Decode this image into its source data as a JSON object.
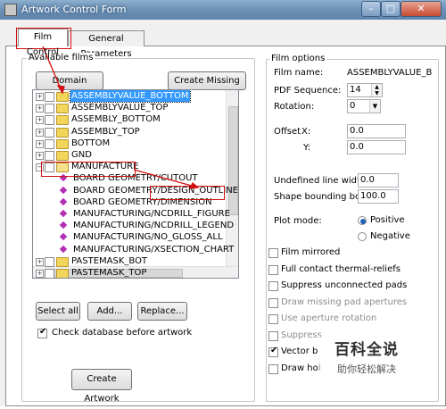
{
  "window": {
    "title": "Artwork Control Form",
    "min_icon": "minimize-icon",
    "max_icon": "maximize-icon",
    "close_icon": "close-icon"
  },
  "tabs": [
    {
      "label": "Film Control",
      "active": true
    },
    {
      "label": "General Parameters",
      "active": false
    }
  ],
  "available_films": {
    "label": "Available films",
    "domain_selection": "Domain Selection",
    "create_missing": "Create Missing Films",
    "items": [
      {
        "label": "ASSEMBLYVALUE_BOTTOM",
        "type": "folder",
        "selected": true
      },
      {
        "label": "ASSEMBLYVALUE_TOP",
        "type": "folder"
      },
      {
        "label": "ASSEMBLY_BOTTOM",
        "type": "folder"
      },
      {
        "label": "ASSEMBLY_TOP",
        "type": "folder"
      },
      {
        "label": "BOTTOM",
        "type": "folder"
      },
      {
        "label": "GND",
        "type": "folder"
      },
      {
        "label": "MANUFACTURE",
        "type": "folder-open"
      },
      {
        "label": "BOARD GEOMETRY/CUTOUT",
        "type": "layer"
      },
      {
        "label": "BOARD GEOMETRY/DESIGN_OUTLINE",
        "type": "layer"
      },
      {
        "label": "BOARD GEOMETRY/DIMENSION",
        "type": "layer"
      },
      {
        "label": "MANUFACTURING/NCDRILL_FIGURE",
        "type": "layer"
      },
      {
        "label": "MANUFACTURING/NCDRILL_LEGEND",
        "type": "layer"
      },
      {
        "label": "MANUFACTURING/NO_GLOSS_ALL",
        "type": "layer"
      },
      {
        "label": "MANUFACTURING/XSECTION_CHART",
        "type": "layer"
      },
      {
        "label": "PASTEMASK_BOT",
        "type": "folder"
      },
      {
        "label": "PASTEMASK_TOP",
        "type": "folder"
      }
    ],
    "select_all": "Select all",
    "add": "Add...",
    "replace": "Replace...",
    "check_db": "Check database before artwork",
    "check_db_checked": true,
    "create_artwork": "Create Artwork"
  },
  "film_options": {
    "label": "Film options",
    "film_name_label": "Film name:",
    "film_name": "ASSEMBLYVALUE_B",
    "pdf_seq_label": "PDF Sequence:",
    "pdf_seq": "14",
    "rotation_label": "Rotation:",
    "rotation": "0",
    "offset_label": "Offset",
    "x_label": "X:",
    "x": "0.0",
    "y_label": "Y:",
    "y": "0.0",
    "undef_width_label": "Undefined line width:",
    "undef_width": "0.0",
    "shape_box_label": "Shape bounding box:",
    "shape_box": "100.0",
    "plot_mode_label": "Plot mode:",
    "positive": "Positive",
    "negative": "Negative",
    "checks": [
      {
        "label": "Film mirrored",
        "checked": false,
        "disabled": false
      },
      {
        "label": "Full contact thermal-reliefs",
        "checked": false,
        "disabled": false
      },
      {
        "label": "Suppress unconnected pads",
        "checked": false,
        "disabled": false
      },
      {
        "label": "Draw missing pad apertures",
        "checked": false,
        "disabled": true
      },
      {
        "label": "Use aperture rotation",
        "checked": false,
        "disabled": true
      },
      {
        "label": "Suppress",
        "checked": false,
        "disabled": true
      },
      {
        "label": "Vector b",
        "checked": true,
        "disabled": false
      },
      {
        "label": "Draw hol",
        "checked": false,
        "disabled": false
      }
    ]
  },
  "watermark": {
    "title": "百科全说",
    "subtitle": "助你轻松解决"
  }
}
